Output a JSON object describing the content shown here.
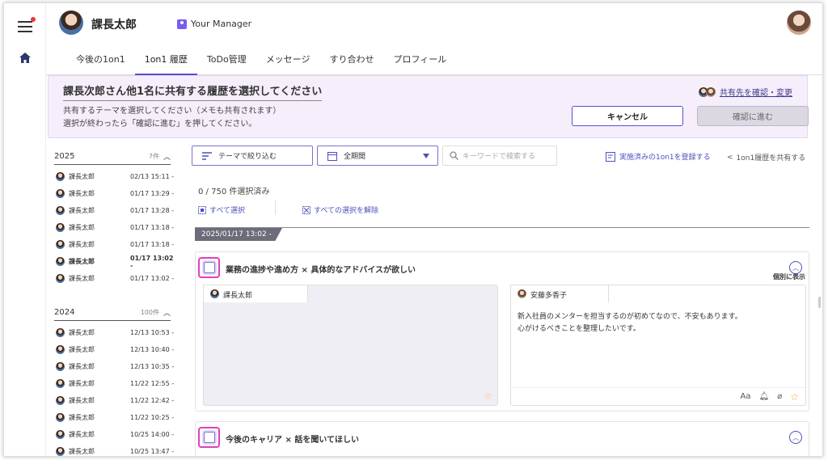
{
  "header": {
    "user_name": "課長太郎",
    "role_label": "Your Manager",
    "tabs": [
      {
        "label": "今後の1on1",
        "active": false
      },
      {
        "label": "1on1 履歴",
        "active": true
      },
      {
        "label": "ToDo管理",
        "active": false
      },
      {
        "label": "メッセージ",
        "active": false
      },
      {
        "label": "すり合わせ",
        "active": false
      },
      {
        "label": "プロフィール",
        "active": false
      }
    ]
  },
  "banner": {
    "title": "課長次郎さん他1名に共有する履歴を選択してください",
    "line1": "共有するテーマを選択してください（メモも共有されます）",
    "line2": "選択が終わったら「確認に進む」を押してください。",
    "share_link": "共有先を確認・変更",
    "cancel": "キャンセル",
    "confirm": "確認に進む"
  },
  "history": {
    "groups": [
      {
        "year": "2025",
        "count": "7件",
        "items": [
          {
            "name": "課長太郎",
            "time": "02/13 15:11 -",
            "bold": false
          },
          {
            "name": "課長太郎",
            "time": "01/17 13:29 -",
            "bold": false
          },
          {
            "name": "課長太郎",
            "time": "01/17 13:28 -",
            "bold": false
          },
          {
            "name": "課長太郎",
            "time": "01/17 13:18 -",
            "bold": false
          },
          {
            "name": "課長太郎",
            "time": "01/17 13:18 -",
            "bold": false
          },
          {
            "name": "課長太郎",
            "time": "01/17 13:02 -",
            "bold": true
          },
          {
            "name": "課長太郎",
            "time": "01/17 13:02 -",
            "bold": false
          }
        ]
      },
      {
        "year": "2024",
        "count": "100件",
        "items": [
          {
            "name": "課長太郎",
            "time": "12/13 10:53 -",
            "bold": false
          },
          {
            "name": "課長太郎",
            "time": "12/13 10:40 -",
            "bold": false
          },
          {
            "name": "課長太郎",
            "time": "12/13 10:35 -",
            "bold": false
          },
          {
            "name": "課長太郎",
            "time": "11/22 12:55 -",
            "bold": false
          },
          {
            "name": "課長太郎",
            "time": "11/22 12:42 -",
            "bold": false
          },
          {
            "name": "課長太郎",
            "time": "11/22 10:25 -",
            "bold": false
          },
          {
            "name": "課長太郎",
            "time": "10/25 14:00 -",
            "bold": false
          },
          {
            "name": "課長太郎",
            "time": "10/25 13:47 -",
            "bold": false
          }
        ]
      }
    ]
  },
  "toolbar": {
    "filter": "テーマで絞り込む",
    "period": "全期間",
    "keyword_placeholder": "キーワードで検索する",
    "register": "実施済みの1on1を登録する",
    "share": "1on1履歴を共有する"
  },
  "selection": {
    "count": "0 / 750 件選択済み",
    "select_all": "すべて選択",
    "deselect_all": "すべての選択を解除"
  },
  "date_tag": "2025/01/17 13:02 -",
  "cards": [
    {
      "title": "業務の進捗や進め方 × 具体的なアドバイスが欲しい",
      "left_name": "課長太郎",
      "right_name": "安藤多香子",
      "individual": "個別に表示",
      "right_text_1": "新入社員のメンターを担当するのが初めてなので、不安もあります。",
      "right_text_2": "心がけるべきことを整理したいです。",
      "font_icon": "Aa"
    },
    {
      "title": "今後のキャリア × 話を聞いてほしい"
    }
  ],
  "colors": {
    "accent": "#5a4fcf",
    "highlight": "#e43fb6",
    "banner_bg": "#f6eefb"
  }
}
